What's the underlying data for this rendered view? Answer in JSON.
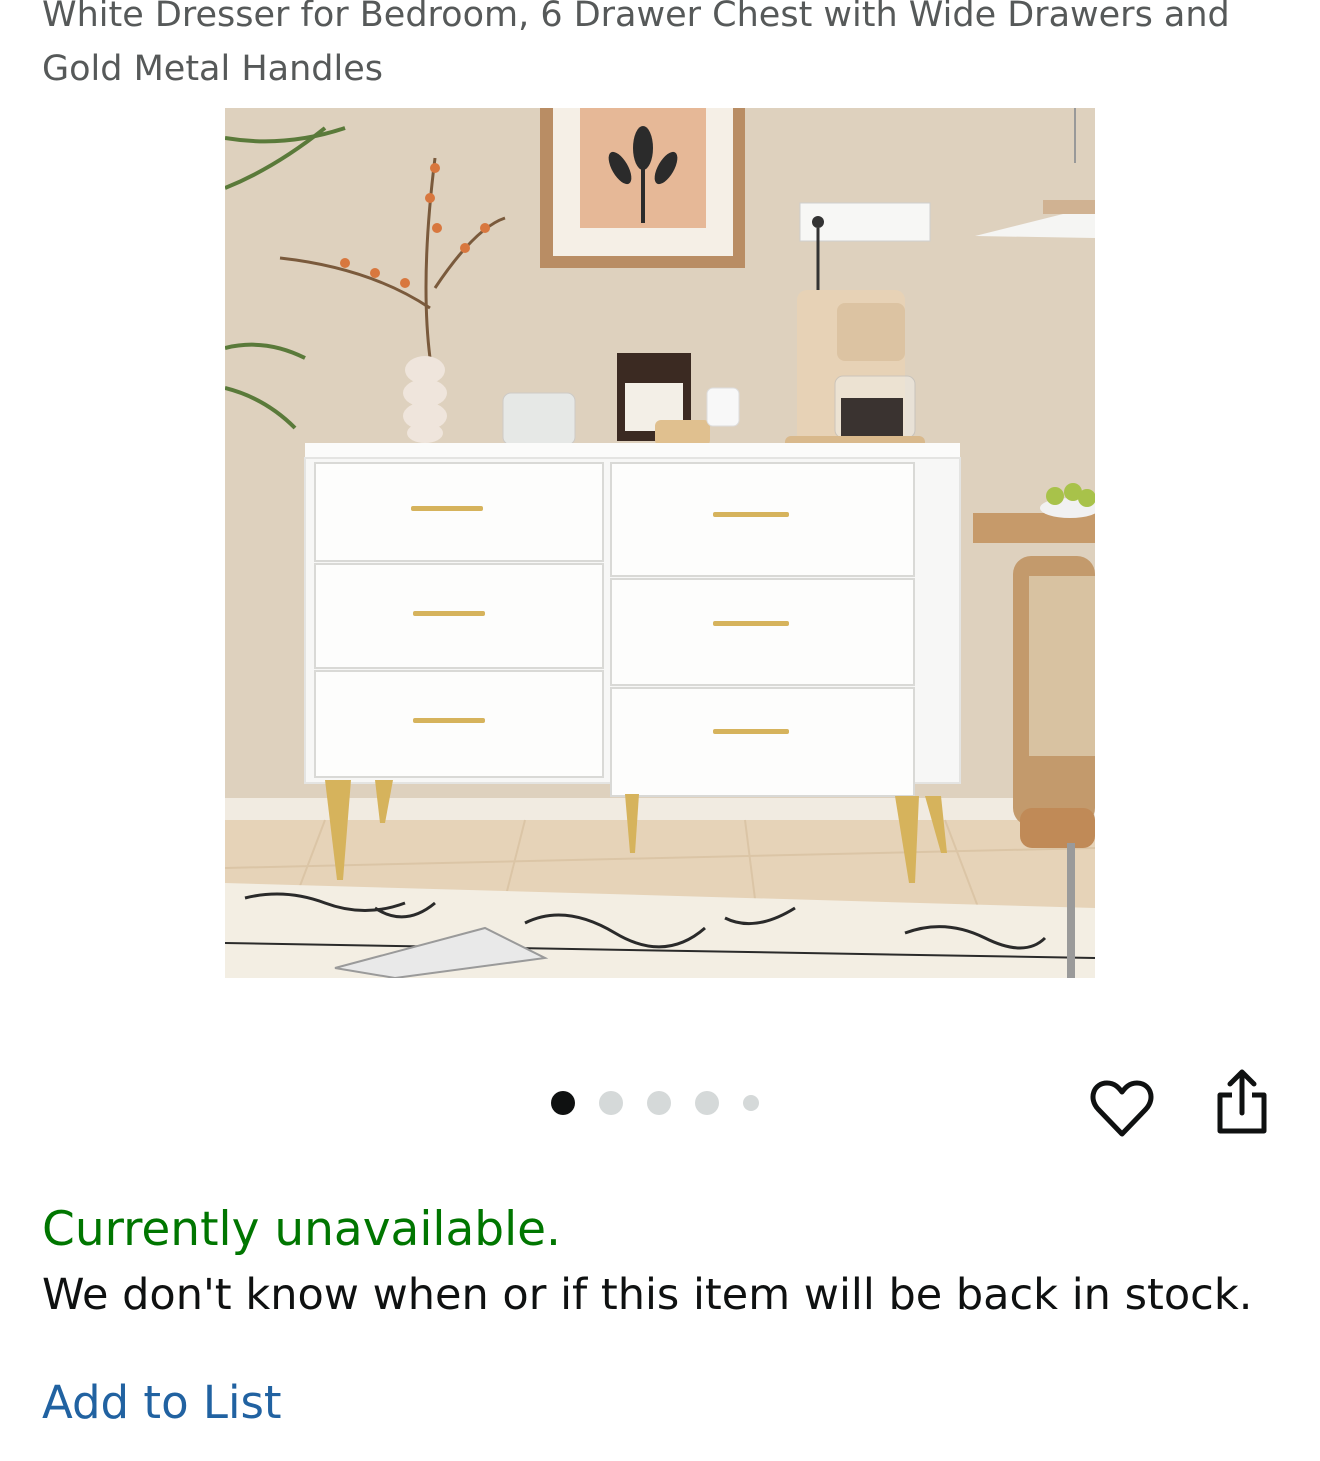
{
  "product": {
    "title": "White Dresser for Bedroom, 6 Drawer Chest with Wide Drawers and Gold Metal Handles",
    "image_alt": "White 6-drawer dresser with gold handles and gold legs in a styled room"
  },
  "carousel": {
    "total_dots": 5,
    "active_index": 0
  },
  "actions": {
    "wishlist_icon": "heart-icon",
    "share_icon": "share-icon"
  },
  "availability": {
    "status": "Currently unavailable.",
    "detail": "We don't know when or if this item will be back in stock."
  },
  "add_to_list": {
    "label": "Add to List"
  },
  "colors": {
    "status_green": "#007600",
    "link_blue": "#2162a1",
    "title_gray": "#565959",
    "dot_active": "#0f1111",
    "dot_inactive": "#d5d9d9"
  }
}
